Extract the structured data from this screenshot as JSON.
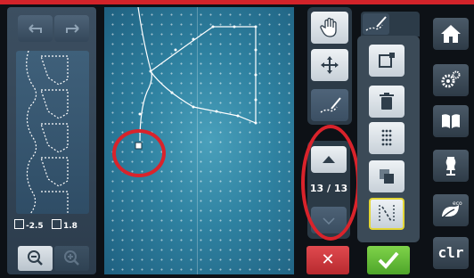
{
  "left_panel": {
    "undo_icon": "undo-icon",
    "redo_icon": "redo-icon",
    "coord_x_label": "-2.5",
    "coord_y_label": "1.8",
    "zoom_out_icon": "zoom-out-icon",
    "zoom_in_icon": "zoom-in-icon"
  },
  "tools": {
    "items": [
      {
        "icon": "hand-icon"
      },
      {
        "icon": "move-icon"
      },
      {
        "icon": "stitch-edit-icon"
      }
    ]
  },
  "scroll": {
    "counter": "13 / 13",
    "up_icon": "arrow-up-icon",
    "down_icon": "arrow-down-icon"
  },
  "cancel_label": "✕",
  "functions": {
    "tab_icon": "stitch-edit-icon",
    "items": [
      {
        "icon": "insert-point-icon"
      },
      {
        "icon": "trash-icon"
      },
      {
        "icon": "stitch-points-icon"
      },
      {
        "icon": "duplicate-icon"
      },
      {
        "icon": "stitch-line-icon"
      }
    ]
  },
  "sidebar": {
    "home_icon": "home-icon",
    "settings_icon": "settings-icon",
    "guide_icon": "book-icon",
    "dressform_icon": "dressform-icon",
    "eco_icon": "eco-icon",
    "eco_label": "eco",
    "clr_label": "clr"
  },
  "colors": {
    "accent_red": "#d2232a",
    "ok_green": "#5fbf35",
    "canvas_blue": "#2f82a1",
    "selection_yellow": "#e3d635"
  }
}
